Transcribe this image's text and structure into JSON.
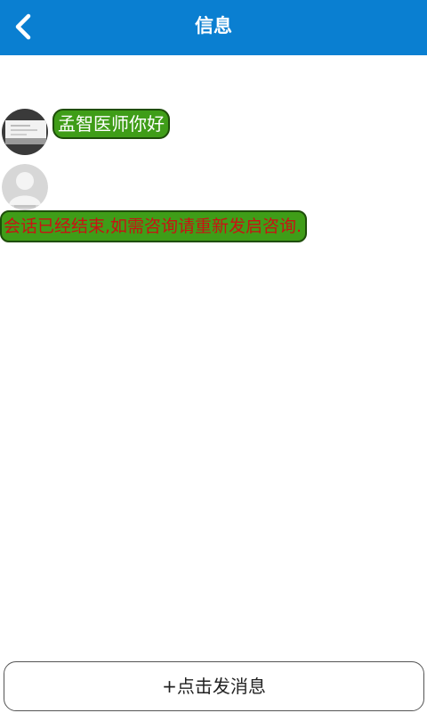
{
  "header": {
    "title": "信息",
    "back_icon": "chevron-left-icon",
    "background_color": "#0a7fd1"
  },
  "messages": [
    {
      "type": "doctor",
      "text": "孟智医师你好",
      "avatar": "doctor-photo-avatar",
      "bubble_color": "#3f9d18",
      "text_color": "#ffffff"
    },
    {
      "type": "system",
      "text": "会话已经结束,如需咨询请重新发启咨询.",
      "avatar": "default-user-avatar",
      "bubble_color": "#3f9d18",
      "text_color": "#c81313"
    }
  ],
  "footer": {
    "send_label": "+点击发消息"
  }
}
